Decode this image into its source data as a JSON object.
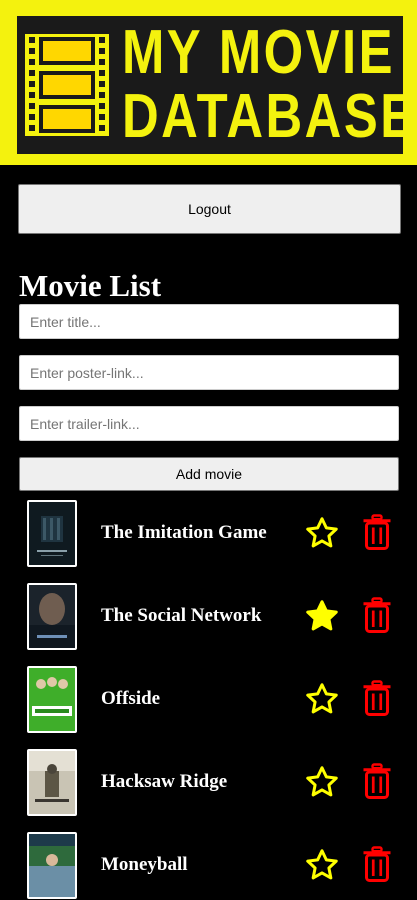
{
  "header": {
    "logo_line1": "MY MOVIE",
    "logo_line2": "DATABASE",
    "logo_color": "#f4f20e",
    "logo_bg": "#1a1a1a"
  },
  "actions": {
    "logout_label": "Logout"
  },
  "movie_list": {
    "title": "Movie List",
    "title_placeholder": "Enter title...",
    "poster_placeholder": "Enter poster-link...",
    "trailer_placeholder": "Enter trailer-link...",
    "add_label": "Add movie"
  },
  "movies": [
    {
      "title": "The Imitation Game",
      "favorite": false,
      "poster_icon": "poster-imitation-game"
    },
    {
      "title": "The Social Network",
      "favorite": true,
      "poster_icon": "poster-social-network"
    },
    {
      "title": "Offside",
      "favorite": false,
      "poster_icon": "poster-offside"
    },
    {
      "title": "Hacksaw Ridge",
      "favorite": false,
      "poster_icon": "poster-hacksaw-ridge"
    },
    {
      "title": "Moneyball",
      "favorite": false,
      "poster_icon": "poster-moneyball"
    }
  ],
  "colors": {
    "star": "#ffff00",
    "trash": "#ff0000",
    "background": "#000000"
  }
}
